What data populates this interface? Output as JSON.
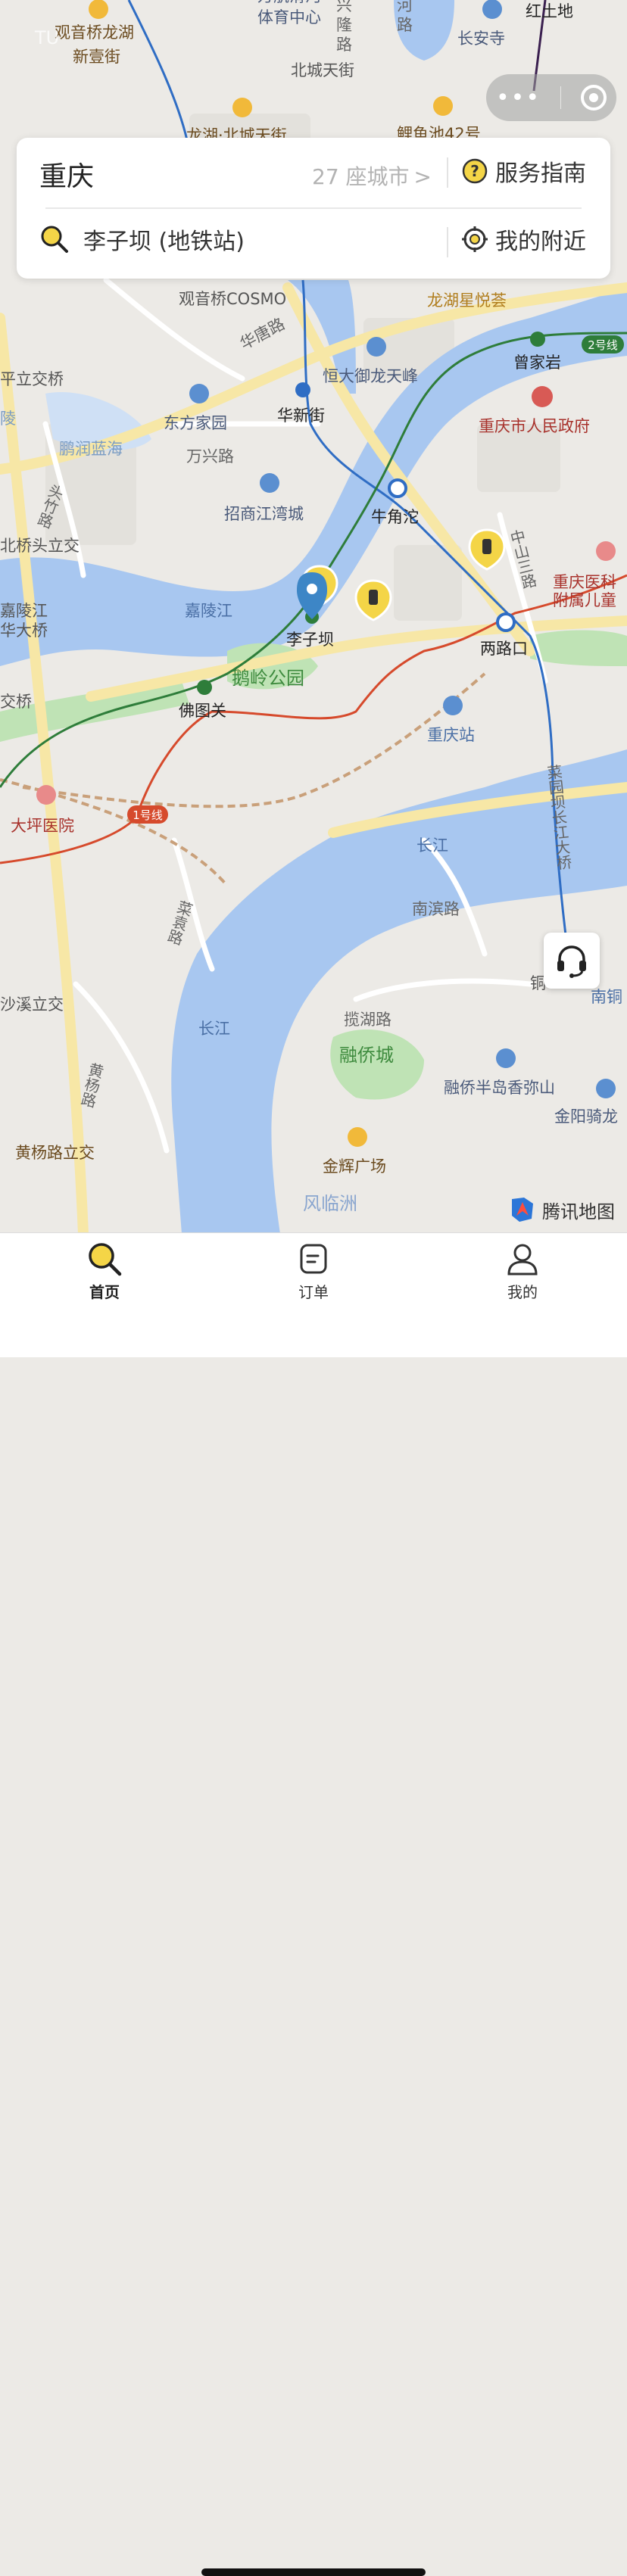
{
  "status_bar": {
    "carrier_faint": "TU"
  },
  "top_card": {
    "city": "重庆",
    "city_count": "27 座城市",
    "guide_label": "服务指南",
    "search_location": "李子坝 (地铁站)",
    "nearby_label": "我的附近"
  },
  "map": {
    "place_labels": [
      {
        "text": "观音桥龙湖",
        "color": "#6b4b1f"
      },
      {
        "text": "新壹街",
        "color": "#6b4b1f"
      },
      {
        "text": "万航滑河",
        "color": "#4a5a7a"
      },
      {
        "text": "体育中心",
        "color": "#4a5a7a"
      },
      {
        "text": "兴",
        "color": "#666"
      },
      {
        "text": "隆",
        "color": "#666"
      },
      {
        "text": "路",
        "color": "#666"
      },
      {
        "text": "河",
        "color": "#666"
      },
      {
        "text": "路",
        "color": "#666"
      },
      {
        "text": "红土地",
        "color": "#222"
      },
      {
        "text": "长安寺",
        "color": "#4a5a7a"
      },
      {
        "text": "北城天街",
        "color": "#555"
      },
      {
        "text": "龙湖·北城天街",
        "color": "#6b4b1f"
      },
      {
        "text": "鲤鱼池42号",
        "color": "#6b4b1f"
      },
      {
        "text": "观音桥COSMO",
        "color": "#555"
      },
      {
        "text": "龙湖星悦荟",
        "color": "#b07d1c"
      },
      {
        "text": "华唐路",
        "color": "#666"
      },
      {
        "text": "恒大御龙天峰",
        "color": "#4a5a7a"
      },
      {
        "text": "曾家岩",
        "color": "#222"
      },
      {
        "text": "平立交桥",
        "color": "#555"
      },
      {
        "text": "东方家园",
        "color": "#4a5a7a"
      },
      {
        "text": "华新街",
        "color": "#222"
      },
      {
        "text": "重庆市人民政府",
        "color": "#a8322c"
      },
      {
        "text": "陵",
        "color": "#7a9cc4"
      },
      {
        "text": "鹏润蓝海",
        "color": "#7a9cc4"
      },
      {
        "text": "万兴路",
        "color": "#666"
      },
      {
        "text": "招商江湾城",
        "color": "#4a5a7a"
      },
      {
        "text": "牛角沱",
        "color": "#222"
      },
      {
        "text": "北桥头立交",
        "color": "#555"
      },
      {
        "text": "重庆医科",
        "color": "#a8322c"
      },
      {
        "text": "附属儿童",
        "color": "#a8322c"
      },
      {
        "text": "嘉陵江",
        "color": "#4a6fa5"
      },
      {
        "text": "嘉陵江",
        "color": "#555"
      },
      {
        "text": "华大桥",
        "color": "#555"
      },
      {
        "text": "李子坝",
        "color": "#222"
      },
      {
        "text": "两路口",
        "color": "#222"
      },
      {
        "text": "鹅岭公园",
        "color": "#3d8a3d"
      },
      {
        "text": "交桥",
        "color": "#555"
      },
      {
        "text": "佛图关",
        "color": "#222"
      },
      {
        "text": "重庆站",
        "color": "#4a6fa5"
      },
      {
        "text": "大坪医院",
        "color": "#a8322c"
      },
      {
        "text": "长江",
        "color": "#4a6fa5"
      },
      {
        "text": "南滨路",
        "color": "#666"
      },
      {
        "text": "沙溪立交",
        "color": "#555"
      },
      {
        "text": "长江",
        "color": "#4a6fa5"
      },
      {
        "text": "揽湖路",
        "color": "#666"
      },
      {
        "text": "融侨城",
        "color": "#3d8a3d"
      },
      {
        "text": "融侨半岛香弥山",
        "color": "#4a5a7a"
      },
      {
        "text": "金阳骑龙",
        "color": "#4a5a7a"
      },
      {
        "text": "黄杨路立交",
        "color": "#6b4b1f"
      },
      {
        "text": "金辉广场",
        "color": "#6b4b1f"
      },
      {
        "text": "风临洲",
        "color": "#8aa6cf"
      },
      {
        "text": "铜",
        "color": "#555"
      },
      {
        "text": "南铜",
        "color": "#4a6fa5"
      }
    ],
    "road_vertical_labels": [
      {
        "text": "头竹路"
      },
      {
        "text": "中山三路"
      },
      {
        "text": "菜园坝长江大桥"
      },
      {
        "text": "菜袁路"
      },
      {
        "text": "黄杨路"
      }
    ],
    "line_badges": [
      "2号线",
      "1号线"
    ],
    "colors": {
      "water": "#a8c7f0",
      "land": "#eceae6",
      "park": "#bfe3b5",
      "road_main": "#f7e7a6",
      "road_minor": "#ffffff",
      "line_blue": "#2f6dc4",
      "line_green": "#2e7d3a",
      "line_red": "#d64a2c",
      "marker_yellow": "#f4d547",
      "pin_blue": "#3d86c6"
    }
  },
  "brand": {
    "name": "腾讯地图"
  },
  "tabs": [
    {
      "label": "首页",
      "icon": "home-search-icon"
    },
    {
      "label": "订单",
      "icon": "order-icon"
    },
    {
      "label": "我的",
      "icon": "profile-icon"
    }
  ]
}
